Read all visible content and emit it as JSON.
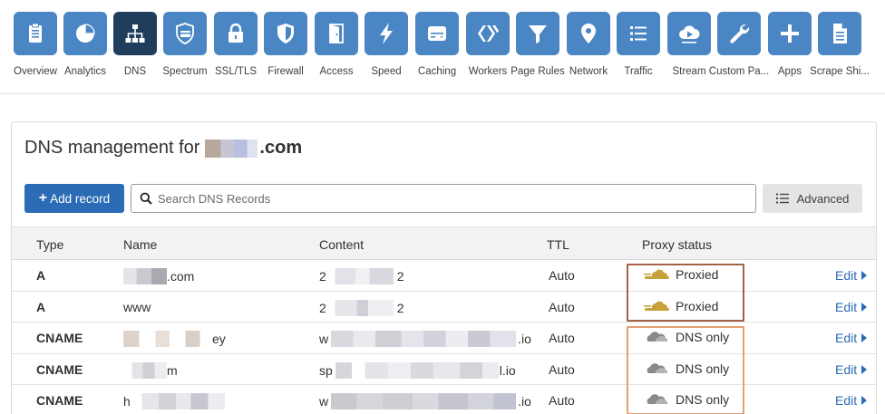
{
  "nav": {
    "items": [
      {
        "label": "Overview",
        "icon": "clipboard-icon"
      },
      {
        "label": "Analytics",
        "icon": "pie-chart-icon"
      },
      {
        "label": "DNS",
        "icon": "network-tree-icon",
        "active": true
      },
      {
        "label": "Spectrum",
        "icon": "shield-card-icon"
      },
      {
        "label": "SSL/TLS",
        "icon": "lock-icon"
      },
      {
        "label": "Firewall",
        "icon": "shield-icon"
      },
      {
        "label": "Access",
        "icon": "door-icon"
      },
      {
        "label": "Speed",
        "icon": "lightning-icon"
      },
      {
        "label": "Caching",
        "icon": "server-drive-icon"
      },
      {
        "label": "Workers",
        "icon": "workers-chevron-icon"
      },
      {
        "label": "Page Rules",
        "icon": "filter-icon"
      },
      {
        "label": "Network",
        "icon": "location-pin-icon"
      },
      {
        "label": "Traffic",
        "icon": "list-icon"
      },
      {
        "label": "Stream",
        "icon": "cloud-play-icon"
      },
      {
        "label": "Custom Pa...",
        "icon": "wrench-icon"
      },
      {
        "label": "Apps",
        "icon": "plus-icon"
      },
      {
        "label": "Scrape Shi...",
        "icon": "document-icon"
      }
    ]
  },
  "dns": {
    "title_prefix": "DNS management for",
    "title_suffix": ".com",
    "add_label": "Add record",
    "search_placeholder": "Search DNS Records",
    "advanced_label": "Advanced",
    "columns": {
      "type": "Type",
      "name": "Name",
      "content": "Content",
      "ttl": "TTL",
      "proxy": "Proxy status"
    },
    "edit_label": "Edit",
    "records": [
      {
        "type": "A",
        "name_prefix": "",
        "name_suffix": ".com",
        "content_prefix": "2",
        "content_suffix": "2",
        "ttl": "Auto",
        "proxy": "Proxied",
        "proxied": true
      },
      {
        "type": "A",
        "name_prefix": "www",
        "name_suffix": "",
        "content_prefix": "2",
        "content_suffix": "2",
        "ttl": "Auto",
        "proxy": "Proxied",
        "proxied": true
      },
      {
        "type": "CNAME",
        "name_prefix": "",
        "name_suffix": "ey",
        "content_prefix": "w",
        "content_suffix": ".io",
        "ttl": "Auto",
        "proxy": "DNS only",
        "proxied": false
      },
      {
        "type": "CNAME",
        "name_prefix": "",
        "name_suffix": "m",
        "content_prefix": "sp",
        "content_suffix": "l.io",
        "ttl": "Auto",
        "proxy": "DNS only",
        "proxied": false
      },
      {
        "type": "CNAME",
        "name_prefix": "h",
        "name_suffix": "",
        "content_prefix": "w",
        "content_suffix": ".io",
        "ttl": "Auto",
        "proxy": "DNS only",
        "proxied": false
      }
    ]
  },
  "colors": {
    "nav_tile": "#4b86c4",
    "nav_tile_active": "#1f3e5c",
    "primary_button": "#2c6bb5",
    "proxied_cloud": "#c9a13a",
    "dns_only_cloud": "#8a8a8a",
    "highlight_dark": "#a36146",
    "highlight_light": "#e5a074"
  }
}
